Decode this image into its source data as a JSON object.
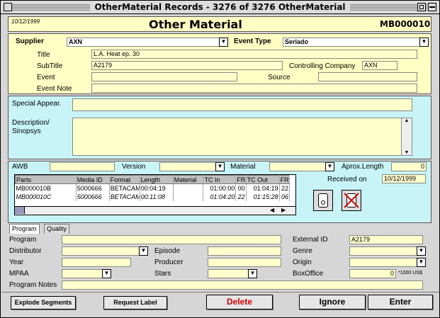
{
  "window": {
    "title": "OtherMaterial Records - 3276 of 3276 OtherMaterial"
  },
  "header": {
    "date": "10/12/1999",
    "title": "Other Material",
    "record_id": "MB000010"
  },
  "record": {
    "supplier_label": "Supplier",
    "supplier": "AXN",
    "event_type_label": "Event Type",
    "event_type": "Seriado",
    "title_label": "Title",
    "title": "L.A. Heat ep. 30",
    "subtitle_label": "SubTitle",
    "subtitle": "A2179",
    "controlling_company_label": "Controlling Company",
    "controlling_company": "AXN",
    "event_label": "Event",
    "event": "",
    "source_label": "Source",
    "source": "",
    "event_note_label": "Event Note",
    "event_note": ""
  },
  "description": {
    "special_appear_label": "Special Appear.",
    "desc_label_1": "Description/",
    "desc_label_2": "Sinopsys"
  },
  "material": {
    "awb_label": "AWB",
    "version_label": "Version",
    "material_label": "Material",
    "aprox_length_label": "Aprox.Length",
    "aprox_length": "0",
    "received_on_label": "Received on",
    "received_on": "10/12/1999",
    "columns": [
      "Parts",
      "Media ID",
      "Format",
      "Length",
      "Material",
      "TC In",
      "FR",
      "TC Out",
      "FR"
    ],
    "rows": [
      [
        "MB000010B",
        "5000666",
        "BETACAM",
        "00:04:19",
        "",
        "01:00:00",
        "00",
        "01:04:19",
        "22"
      ],
      [
        "MB000010C",
        "5000666",
        "BETACAM",
        "00:11:08",
        "",
        "01:04:20",
        "22",
        "01:15:28",
        "06"
      ]
    ]
  },
  "tabs": {
    "program": "Program",
    "quality": "Quality"
  },
  "program": {
    "program_label": "Program",
    "external_id_label": "External ID",
    "external_id": "A2179",
    "distributor_label": "Distributor",
    "episode_label": "Episode",
    "genre_label": "Genre",
    "year_label": "Year",
    "producer_label": "Producer",
    "origin_label": "Origin",
    "mpaa_label": "MPAA",
    "stars_label": "Stars",
    "box_office_label": "BoxOffice",
    "box_office": "0",
    "box_office_unit": "*1000 US$",
    "program_notes_label": "Program Notes"
  },
  "footer": {
    "explode": "Explode Segments",
    "request_label": "Request Label",
    "delete": "Delete",
    "ignore": "Ignore",
    "enter": "Enter"
  },
  "colors": {
    "panel_yellow": "#ffffc4",
    "panel_cyan": "#c8f4f8",
    "delete_red": "#cc0000"
  }
}
